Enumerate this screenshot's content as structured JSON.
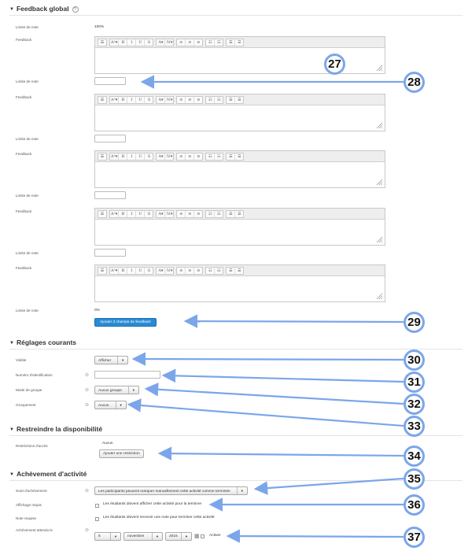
{
  "feedback_section": {
    "title": "Feedback global",
    "grade_boundary_label": "Limite de note",
    "feedback_label": "Feedback",
    "first_boundary_value": "100%",
    "last_boundary_value": "0%",
    "add_fields_button": "Ajouter 3 champs de feedback",
    "toolbar": {
      "groups": [
        [
          "☰"
        ],
        [
          "Aᴬ▾",
          "B",
          "I",
          "U",
          "S"
        ],
        [
          "A▾",
          "ℳ▾"
        ],
        [
          "≡",
          "≡",
          "≡"
        ],
        [
          "☷",
          "☷"
        ],
        [
          "☰",
          "☰"
        ]
      ]
    }
  },
  "common_settings": {
    "title": "Réglages courants",
    "visible_label": "Visible",
    "visible_value": "Afficher",
    "idnumber_label": "Numéro d'identification",
    "groupmode_label": "Mode de groupe",
    "groupmode_value": "Aucun groupe",
    "grouping_label": "Groupement",
    "grouping_value": "Aucun"
  },
  "restrict_section": {
    "title": "Restreindre la disponibilité",
    "access_label": "Restrictions d'accès",
    "access_value": "Aucun",
    "add_restriction_button": "Ajouter une restriction"
  },
  "completion_section": {
    "title": "Achèvement d'activité",
    "tracking_label": "Suivi d'achèvement",
    "tracking_value": "Les participants peuvent marquer manuellement cette activité comme terminée",
    "view_label": "Affichage requis",
    "view_text": "Les étudiants doivent afficher cette activité pour la terminer",
    "grade_label": "Note requise",
    "grade_text": "Les étudiants doivent recevoir une note pour terminer cette activité",
    "expected_label": "Achèvement attendu le",
    "day": "6",
    "month": "novembre",
    "year": "2015",
    "enable_label": "Activer"
  },
  "badges": [
    "27",
    "28",
    "29",
    "30",
    "31",
    "32",
    "33",
    "34",
    "35",
    "36",
    "37"
  ],
  "colors": {
    "accent": "#2a8ad3",
    "badge_border": "#7ba6ea"
  }
}
